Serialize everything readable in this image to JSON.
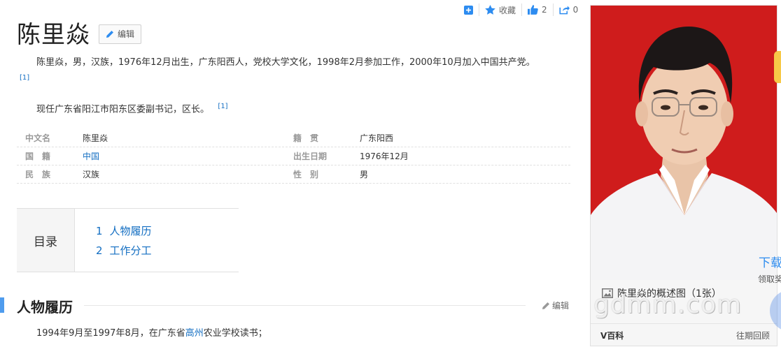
{
  "actions": {
    "collect_label": "收藏",
    "like_count": "2",
    "share_count": "0"
  },
  "title": "陈里焱",
  "edit_label": "编辑",
  "summary": {
    "line1": "陈里焱，男，汉族，1976年12月出生，广东阳西人，党校大学文化，1998年2月参加工作，2000年10月加入中国共产党。",
    "ref1": "[1]",
    "line2": "现任广东省阳江市阳东区委副书记，区长。",
    "ref2": "[1]"
  },
  "info": [
    {
      "k1": "中文名",
      "v1": "陈里焱",
      "k2": "籍　贯",
      "v2": "广东阳西"
    },
    {
      "k1": "国　籍",
      "v1": "中国",
      "k2": "出生日期",
      "v2": "1976年12月"
    },
    {
      "k1": "民　族",
      "v1": "汉族",
      "k2": "性　别",
      "v2": "男"
    }
  ],
  "catalog": {
    "heading": "目录",
    "items": [
      {
        "num": "1",
        "label": "人物履历"
      },
      {
        "num": "2",
        "label": "工作分工"
      }
    ]
  },
  "section": {
    "title": "人物履历",
    "edit_label": "编辑",
    "text_before": "1994年9月至1997年8月，在广东省",
    "text_link": "高州",
    "text_after": "农业学校读书；"
  },
  "photo": {
    "caption": "陈里焱的概述图（1张）",
    "watermark": "gdmm.com",
    "footer_brand": "V百科",
    "footer_more": "往期回顾"
  },
  "ad": {
    "download": "下载",
    "sub": "领取奖"
  },
  "colors": {
    "link": "#136ec2",
    "photo_bg": "#cf1c1c",
    "section_accent": "#4f9cee"
  }
}
